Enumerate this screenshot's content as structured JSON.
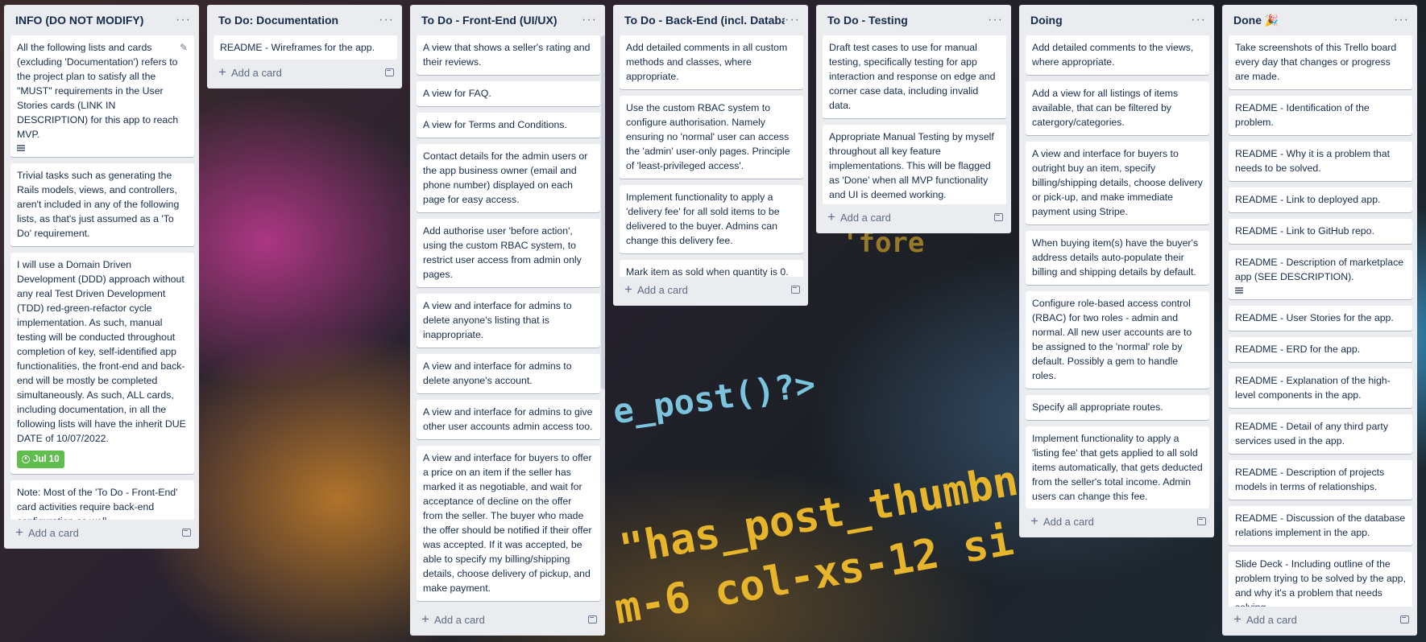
{
  "board": {
    "add_card_label": "Add a card",
    "lists": [
      {
        "title": "INFO (DO NOT MODIFY)",
        "cards": [
          "All the following lists and cards (excluding 'Documentation') refers to the project plan to satisfy all the \"MUST\" requirements in the User Stories cards (LINK IN DESCRIPTION) for this app to reach MVP.",
          "Trivial tasks such as generating the Rails models, views, and controllers, aren't included in any of the following lists, as that's just assumed as a 'To Do' requirement.",
          "I will use a Domain Driven Development (DDD) approach without any real Test Driven Development (TDD) red-green-refactor cycle implementation. As such, manual testing will be conducted throughout completion of key, self-identified app functionalities, the front-end and back-end will be mostly be completed simultaneously. As such, ALL cards, including documentation, in all the following lists will have the inherit DUE DATE of 10/07/2022.",
          "Note: Most of the 'To Do - Front-End' card activities require back-end configuration as well."
        ],
        "due_badge": "Jul 10"
      },
      {
        "title": "To Do: Documentation",
        "cards": [
          "README - Wireframes for the app."
        ]
      },
      {
        "title": "To Do - Front-End (UI/UX)",
        "cards": [
          "A view that shows a seller's rating and their reviews.",
          "A view for FAQ.",
          "A view for Terms and Conditions.",
          "Contact details for the admin users or the app business owner (email and phone number) displayed on each page for easy access.",
          "Add authorise user 'before action', using the custom RBAC system, to restrict user access from admin only pages.",
          "A view and interface for admins to delete anyone's listing that is inappropriate.",
          "A view and interface for admins to delete anyone's account.",
          "A view and interface for admins to give other user accounts admin access too.",
          "A view and interface for buyers to offer a price on an item if the seller has marked it as negotiable, and wait for acceptance of decline on the offer from the seller. The buyer who made the offer should be notified if their offer was accepted. If it was accepted, be able to specify my billing/shipping details, choose delivery of pickup, and make payment."
        ]
      },
      {
        "title": "To Do - Back-End (incl. Database)",
        "cards": [
          "Add detailed comments in all custom methods and classes, where appropriate.",
          "Use the custom RBAC system to configure authorisation. Namely ensuring no 'normal' user can access the 'admin' user-only pages. Principle of 'least-privileged access'.",
          "Implement functionality to apply a 'delivery fee' for all sold items to be delivered to the buyer. Admins can change this delivery fee.",
          "Mark item as sold when quantity is 0."
        ]
      },
      {
        "title": "To Do - Testing",
        "cards": [
          "Draft test cases to use for manual testing, specifically testing for app interaction and response on edge and corner case data, including invalid data.",
          "Appropriate Manual Testing by myself throughout all key feature implementations. This will be flagged as 'Done' when all MVP functionality and UI is deemed working."
        ]
      },
      {
        "title": "Doing",
        "cards": [
          "Add detailed comments to the views, where appropriate.",
          "Add a view for all listings of items available, that can be filtered by catergory/categories.",
          "A view and interface for buyers to outright buy an item, specify billing/shipping details, choose delivery or pick-up, and make immediate payment using Stripe.",
          "When buying item(s) have the buyer's address details auto-populate their billing and shipping details by default.",
          "Configure role-based access control (RBAC) for two roles - admin and normal. All new user accounts are to be assigned to the 'normal' role by default. Possibly a gem to handle roles.",
          "Specify all appropriate routes.",
          "Implement functionality to apply a 'listing fee' that gets applied to all sold items automatically, that gets deducted from the seller's total income. Admin users can change this fee."
        ]
      },
      {
        "title": "Done 🎉",
        "cards": [
          "Take screenshots of this Trello board every day that changes or progress are made.",
          "README - Identification of the problem.",
          "README - Why it is a problem that needs to be solved.",
          "README - Link to deployed app.",
          "README - Link to GitHub repo.",
          "README - Description of marketplace app (SEE DESCRIPTION).",
          "README - User Stories for the app.",
          "README - ERD for the app.",
          "README - Explanation of the high-level components in the app.",
          "README - Detail of any third party services used in the app.",
          "README - Description of projects models in terms of relationships.",
          "README - Discussion of the database relations implement in the app.",
          "Slide Deck - Including outline of the problem trying to be solved by the app, and why it's a problem that needs solving."
        ]
      }
    ]
  },
  "background_code": {
    "line1": "e_post()?>",
    "line2": "\"has_post_thumbnail\"",
    "line3": "m-6 col-xs-12 si",
    "line4": "'fore"
  }
}
